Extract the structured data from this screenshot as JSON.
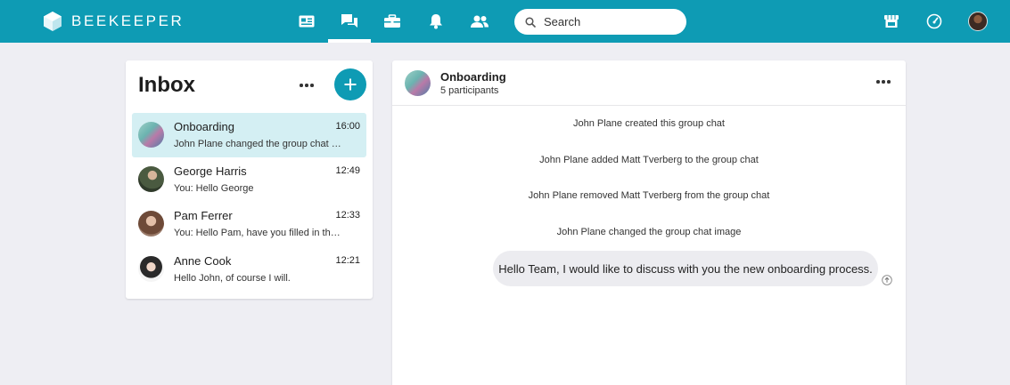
{
  "brand": {
    "name": "BEEKEEPER"
  },
  "nav": {
    "items": [
      {
        "icon": "news-icon"
      },
      {
        "icon": "chat-icon",
        "active": true
      },
      {
        "icon": "toolbox-icon"
      },
      {
        "icon": "bell-icon"
      },
      {
        "icon": "people-icon"
      }
    ],
    "search_placeholder": "Search",
    "right_icons": [
      "store-icon",
      "dashboard-icon",
      "user-avatar"
    ]
  },
  "colors": {
    "brand": "#0e9bb4",
    "active_row": "#d4eff3",
    "bubble": "#ececf0",
    "background": "#eeeef3"
  },
  "inbox": {
    "title": "Inbox",
    "conversations": [
      {
        "name": "Onboarding",
        "time": "16:00",
        "preview": "John Plane changed the group chat image",
        "active": true
      },
      {
        "name": "George Harris",
        "time": "12:49",
        "preview": "You: Hello George"
      },
      {
        "name": "Pam Ferrer",
        "time": "12:33",
        "preview": "You: Hello Pam, have you filled in the form?"
      },
      {
        "name": "Anne Cook",
        "time": "12:21",
        "preview": "Hello John, of course I will."
      }
    ]
  },
  "chat": {
    "title": "Onboarding",
    "participants": "5 participants",
    "system_messages": [
      "John Plane created this group chat",
      "John Plane added Matt Tverberg to the group chat",
      "John Plane removed Matt Tverberg from the group chat",
      "John Plane changed the group chat image"
    ],
    "message": "Hello Team, I would like to discuss with you the new onboarding process."
  }
}
